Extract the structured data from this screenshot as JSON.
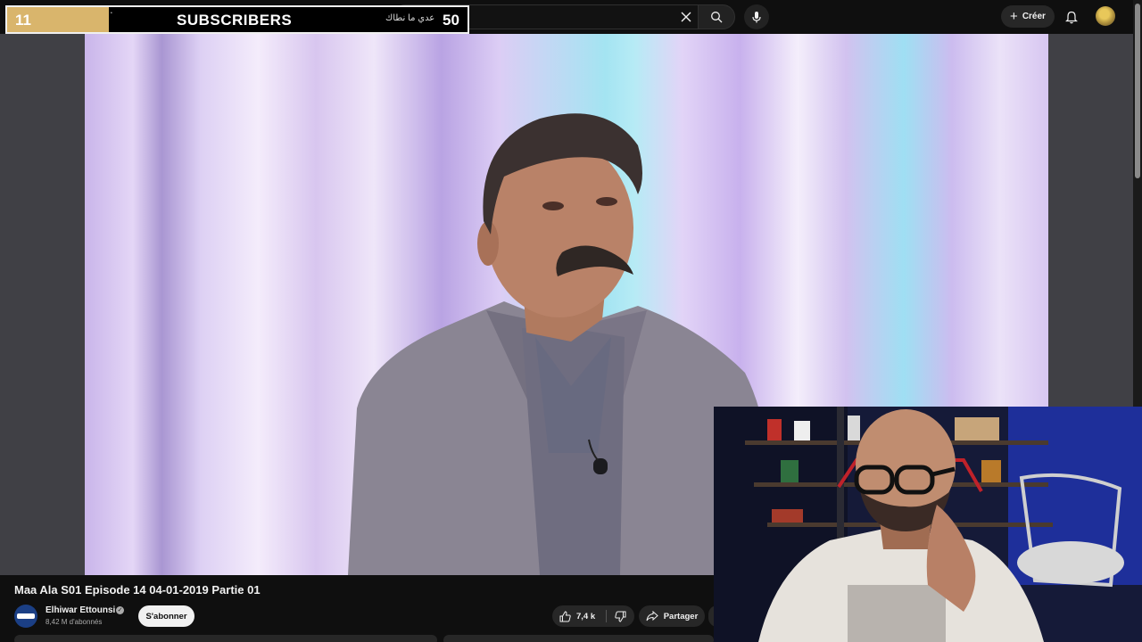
{
  "overlay": {
    "subscriber_count": "11",
    "label": "SUBSCRIBERS",
    "arabic_text": "عدي ما نطاك",
    "goal": "50",
    "progress_fraction": 0.22
  },
  "topbar": {
    "create_label": "Créer",
    "icons": [
      "close-icon",
      "search-icon",
      "microphone-icon",
      "plus-icon",
      "bell-icon"
    ]
  },
  "video": {
    "title": "Maa Ala S01 Episode 14 04-01-2019 Partie 01"
  },
  "channel": {
    "name": "Elhiwar Ettounsi",
    "subscribers": "8,42 M d'abonnés",
    "subscribe_label": "S'abonner",
    "verified_icon": "check-badge-icon"
  },
  "actions": {
    "like_count": "7,4 k",
    "share_label": "Partager",
    "icons": [
      "thumbs-up-icon",
      "thumbs-down-icon",
      "share-arrow-icon"
    ]
  },
  "colors": {
    "background": "#0f0f0f",
    "overlay_progress": "#d9b56c",
    "button_bg": "#272727"
  }
}
